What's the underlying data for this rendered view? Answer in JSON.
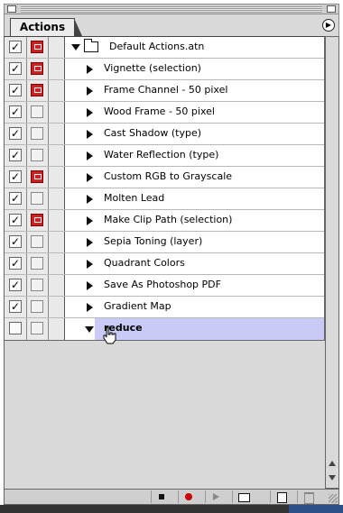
{
  "panel": {
    "tab_label": "Actions",
    "menu_icon": "panel-menu-icon"
  },
  "set": {
    "name": "Default Actions.atn",
    "checked": true,
    "dialog": true,
    "expanded": true
  },
  "actions": [
    {
      "label": "Vignette (selection)",
      "checked": true,
      "dialog": true
    },
    {
      "label": "Frame Channel - 50 pixel",
      "checked": true,
      "dialog": true
    },
    {
      "label": "Wood Frame - 50 pixel",
      "checked": true,
      "dialog": false
    },
    {
      "label": "Cast Shadow (type)",
      "checked": true,
      "dialog": false
    },
    {
      "label": "Water Reflection (type)",
      "checked": true,
      "dialog": false
    },
    {
      "label": "Custom RGB to Grayscale",
      "checked": true,
      "dialog": true
    },
    {
      "label": "Molten Lead",
      "checked": true,
      "dialog": false
    },
    {
      "label": "Make Clip Path (selection)",
      "checked": true,
      "dialog": true
    },
    {
      "label": "Sepia Toning (layer)",
      "checked": true,
      "dialog": false
    },
    {
      "label": "Quadrant Colors",
      "checked": true,
      "dialog": false
    },
    {
      "label": "Save As Photoshop PDF",
      "checked": true,
      "dialog": false
    },
    {
      "label": "Gradient Map",
      "checked": true,
      "dialog": false
    }
  ],
  "selected_action": {
    "label": "reduce",
    "checked": false,
    "dialog": false,
    "expanded": true
  },
  "toolbar": {
    "buttons": [
      "stop-button",
      "record-button",
      "play-button",
      "new-set-button",
      "new-action-button",
      "delete-button"
    ]
  },
  "colors": {
    "selection": "#c9cbf6",
    "dialog_on": "#cc2222",
    "record": "#cc0000"
  }
}
